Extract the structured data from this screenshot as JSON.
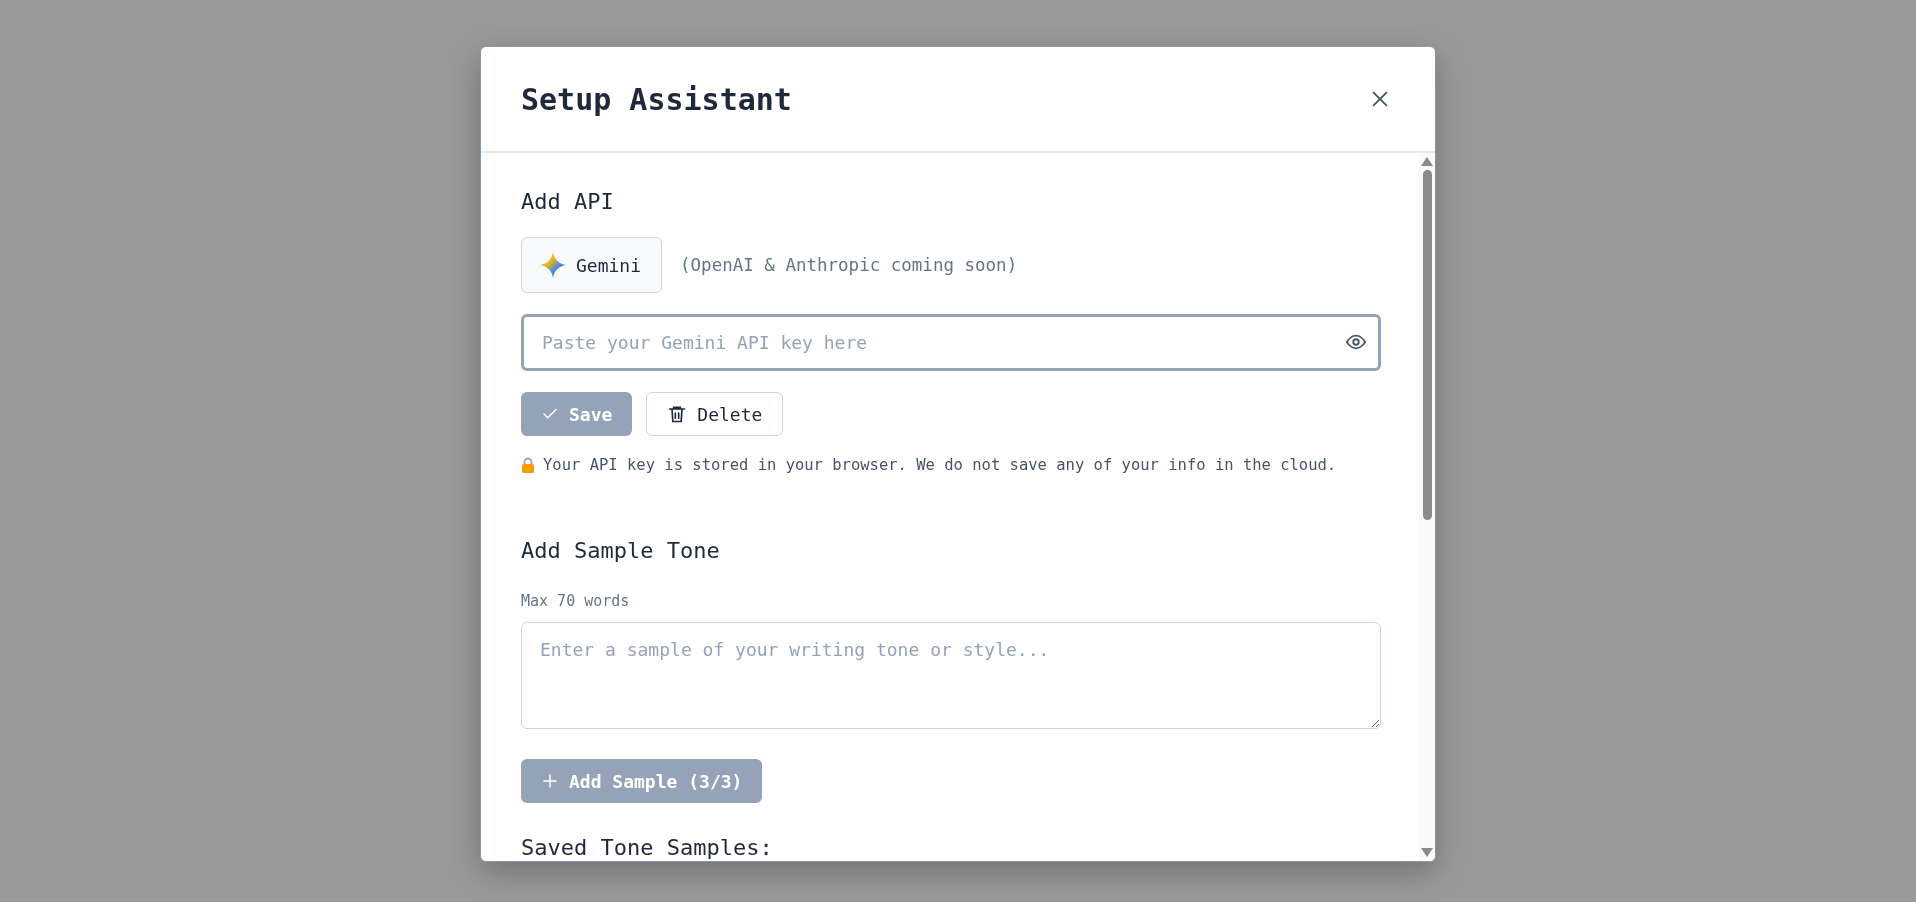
{
  "dialog": {
    "title": "Setup Assistant"
  },
  "api_section": {
    "heading": "Add API",
    "provider": {
      "label": "Gemini"
    },
    "provider_note": "(OpenAI & Anthropic coming soon)",
    "key_field": {
      "placeholder": "Paste your Gemini API key here"
    },
    "buttons": [
      {
        "kind": "save",
        "label": "Save",
        "disabled": true
      },
      {
        "kind": "delete",
        "label": "Delete",
        "disabled": false
      }
    ],
    "privacy_note": "Your API key is stored in your browser. We do not save any of your info in the cloud."
  },
  "tone_section": {
    "heading": "Add Sample Tone",
    "hint": "Max 70 words",
    "sample_field": {
      "placeholder": "Enter a sample of your writing tone or style..."
    },
    "add_button": {
      "label": "Add Sample (3/3)",
      "disabled": true
    },
    "saved_heading": "Saved Tone Samples:"
  }
}
